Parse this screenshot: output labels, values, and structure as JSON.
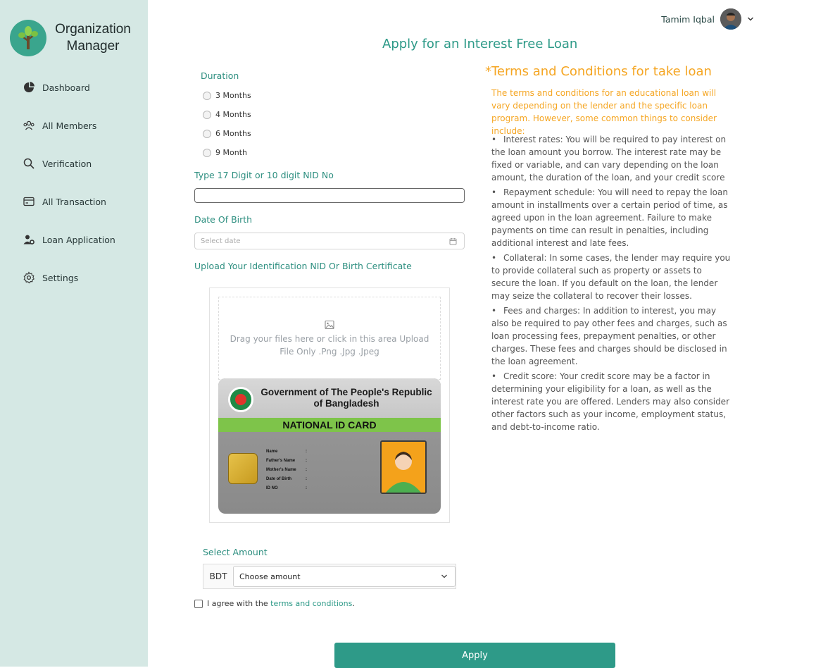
{
  "app": {
    "name": "Organization Manager",
    "name_line1": "Organization",
    "name_line2": "Manager"
  },
  "sidebar": {
    "items": [
      {
        "label": "Dashboard",
        "icon": "pie-chart-icon"
      },
      {
        "label": "All Members",
        "icon": "users-icon"
      },
      {
        "label": "Verification",
        "icon": "search-icon"
      },
      {
        "label": "All Transaction",
        "icon": "credit-card-icon"
      },
      {
        "label": "Loan Application",
        "icon": "user-gear-icon"
      },
      {
        "label": "Settings",
        "icon": "gear-icon"
      }
    ]
  },
  "user": {
    "name": "Tamim Iqbal"
  },
  "form": {
    "title": "Apply for an Interest Free Loan",
    "duration_label": "Duration",
    "durations": [
      "3 Months",
      "4 Months",
      "6 Months",
      "9 Month"
    ],
    "nid_label": "Type 17 Digit or 10 digit NID No",
    "nid_value": "",
    "dob_label": "Date Of Birth",
    "dob_placeholder": "Select date",
    "upload_label": "Upload Your Identification NID Or Birth Certificate",
    "upload_hint": "Drag your files here or click in this area Upload File Only .Png .Jpg .Jpeg",
    "idcard": {
      "gov_title": "Government of The People's Republic of Bangladesh",
      "card_title": "NATIONAL ID CARD",
      "fields": [
        "Name",
        "Father's Name",
        "Mother's Name",
        "Date of Birth",
        "ID NO"
      ],
      "sep": ":"
    },
    "amount_label": "Select Amount",
    "currency": "BDT",
    "amount_placeholder": "Choose amount",
    "agree_prefix": "I agree with the",
    "agree_link": "terms and conditions",
    "agree_suffix": ".",
    "apply_label": "Apply"
  },
  "terms": {
    "title": "*Terms and Conditions for take loan",
    "intro": "The terms and conditions for an educational loan will vary depending on the lender and the specific loan program. However, some common things to consider include:",
    "items": [
      "Interest rates: You will be required to pay interest on the loan amount you borrow. The interest rate may be fixed or variable, and can vary depending on the loan amount, the duration of the loan, and your credit score",
      "Repayment schedule: You will need to repay the loan amount in installments over a certain period of time, as agreed upon in the loan agreement. Failure to make payments on time can result in penalties, including additional interest and late fees.",
      "Collateral: In some cases, the lender may require you to provide collateral such as property or assets to secure the loan. If you default on the loan, the lender may seize the collateral to recover their losses.",
      "Fees and charges: In addition to interest, you may also be required to pay other fees and charges, such as loan processing fees, prepayment penalties, or other charges. These fees and charges should be disclosed in the loan agreement.",
      "Credit score: Your credit score may be a factor in determining your eligibility for a loan, as well as the interest rate you are offered. Lenders may also consider other factors such as your income, employment status, and debt-to-income ratio."
    ]
  },
  "colors": {
    "teal": "#2e9a88",
    "orange": "#f5a623",
    "sidebar_bg": "#d5e8e4"
  }
}
